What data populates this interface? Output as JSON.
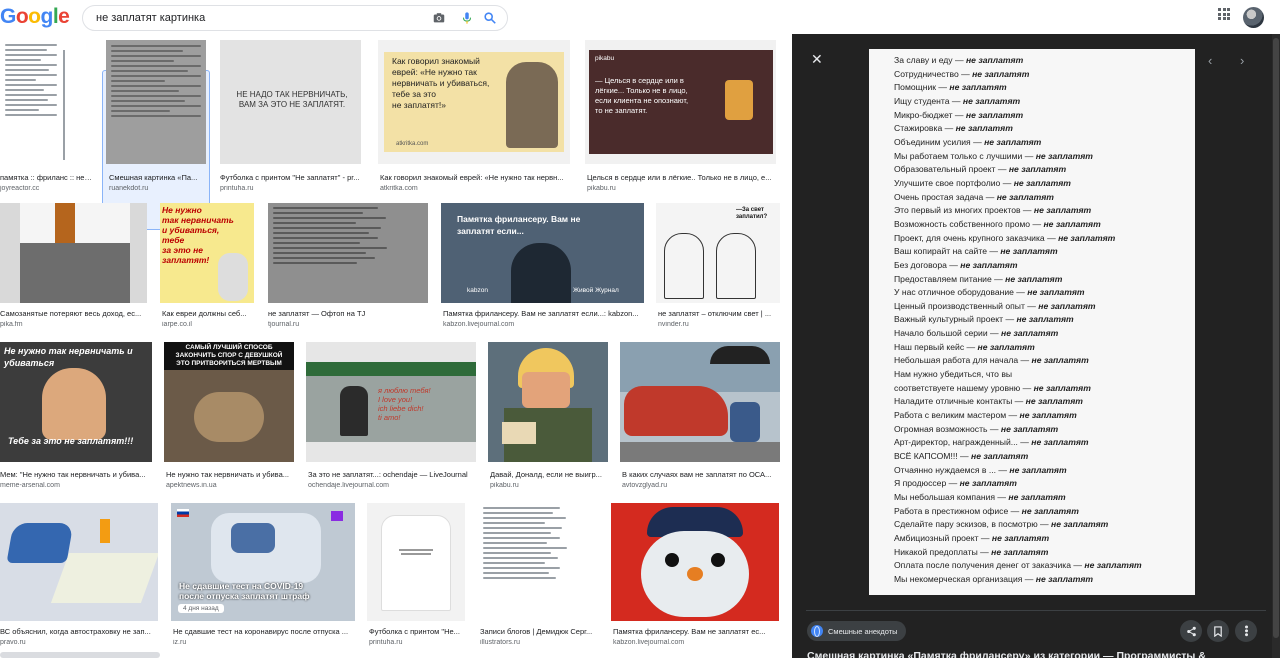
{
  "header": {
    "logo_letters": [
      {
        "ch": "G",
        "color": "#4285F4"
      },
      {
        "ch": "o",
        "color": "#EA4335"
      },
      {
        "ch": "o",
        "color": "#FBBC05"
      },
      {
        "ch": "g",
        "color": "#4285F4"
      },
      {
        "ch": "l",
        "color": "#34A853"
      },
      {
        "ch": "e",
        "color": "#EA4335"
      }
    ],
    "search_query": "не заплатят картинка",
    "icons": [
      "camera-icon",
      "microphone-icon",
      "search-icon",
      "apps-grid-icon"
    ]
  },
  "results": [
    {
      "title": "памятка :: фриланс :: не ...",
      "source": "joyreactor.cc"
    },
    {
      "title": "Смешная картинка «Па...",
      "source": "ruanekdot.ru"
    },
    {
      "title": "Футболка с принтом \"Не заплатят\" - pr...",
      "source": "printuha.ru",
      "inner": "НЕ НАДО ТАК НЕРВНИЧАТЬ,\nВАМ ЗА ЭТО НЕ ЗАПЛАТЯТ."
    },
    {
      "title": "Как говорил знакомый еврей: «Не нужно так нервн...",
      "source": "atkritka.com",
      "inner": "Как говорил знакомый\nеврей: «Не нужно так\nнервничать и убиваться,\nтебе за это\nне заплатят!»",
      "brand": "atkritka.com"
    },
    {
      "title": "Целься в сердце или в лёгкие.. Только не в лицо, е...",
      "source": "pikabu.ru",
      "inner": "— Целься в сердце или в\nлёгкие... Только не в лицо,\nесли клиента не опознают,\nто не заплатят.",
      "brand": "pikabu"
    },
    {
      "title": "Самозанятые потеряют весь доход, ес...",
      "source": "pika.fm"
    },
    {
      "title": "Как евреи должны себ...",
      "source": "iarpe.co.il",
      "inner": "Не нужно\nтак нервничать\nи убиваться,\nтебе\nза это не\nзаплатят!"
    },
    {
      "title": "не заплатят — Офтоп на TJ",
      "source": "tjournal.ru"
    },
    {
      "title": "Памятка фрилансеру. Вам не заплатят если...: kabzon...",
      "source": "kabzon.livejournal.com",
      "inner": "Памятка фрилансеру. Вам не\nзаплатят если...",
      "brand": "kabzon",
      "brand2": "Живой Журнал"
    },
    {
      "title": "не заплатят – отключим свет | ...",
      "source": "nvinder.ru",
      "inner": "—За свет\nзаплатил?"
    },
    {
      "title": "Мем: \"Не нужно так нервничать и убива...",
      "source": "meme-arsenal.com",
      "inner": "Не нужно так нервничать и\nубиваться",
      "inner2": "Тебе за это не заплатят!!!"
    },
    {
      "title": "Не нужно так нервничать и убива...",
      "source": "apektnews.in.ua",
      "inner": "САМЫЙ ЛУЧШИЙ СПОСОБ\nЗАКОНЧИТЬ СПОР С ДЕВУШКОЙ\nЭТО ПРИТВОРИТЬСЯ МЕРТВЫМ"
    },
    {
      "title": "За это не заплатят...: ochendaje — LiveJournal",
      "source": "ochendaje.livejournal.com",
      "inner": "я люблю тебя!\nI love you!\nich liebe dich!\nti amo!"
    },
    {
      "title": "Давай, Доналд, если не выигр...",
      "source": "pikabu.ru"
    },
    {
      "title": "В каких случаях вам не заплатят по ОСА...",
      "source": "avtovzglyad.ru"
    },
    {
      "title": "ВС объяснил, когда автостраховку не зап...",
      "source": "pravo.ru"
    },
    {
      "title": "Не сдавшие тест на коронавирус после отпуска ...",
      "source": "iz.ru",
      "inner": "Не сдавшие тест на COVID-19\nпосле отпуска заплатят штраф",
      "badge": "4 дня назад"
    },
    {
      "title": "Футболка с принтом \"Не...",
      "source": "printuha.ru"
    },
    {
      "title": "Записи блогов | Демидюк Серг...",
      "source": "illustrators.ru"
    },
    {
      "title": "Памятка фрилансеру. Вам не заплатят ес...",
      "source": "kabzon.livejournal.com"
    }
  ],
  "preview": {
    "suffix": "не заплатят",
    "lines": [
      "За славу и еду —",
      "Сотрудничество —",
      "Помощник —",
      "Ищу студента —",
      "Микро-бюджет —",
      "Стажировка —",
      "Объединим усилия —",
      "Мы работаем только с лучшими —",
      "Образовательный проект —",
      "Улучшите свое портфолио —",
      "Очень простая задача —",
      "Это первый из многих проектов —",
      "Возможность собственного промо —",
      "Проект, для очень крупного заказчика —",
      "Ваш копирайт на сайте —",
      "Без договора —",
      "Предоставляем питание —",
      "У нас отличное оборудование —",
      "Ценный производственный опыт —",
      "Важный культурный проект —",
      "Начало большой серии —",
      "Наш первый кейс —",
      "Небольшая работа для начала —",
      "Нам нужно убедиться, что вы",
      "соответствуете нашему уровню —",
      "Наладите отличные контакты —",
      "Работа с великим мастером —",
      "Огромная возможность —",
      "Арт-директор, награжденный... —",
      "ВСЁ КАПСОМ!!! —",
      "Отчаянно нуждаемся в ... —",
      "Я продюссер —",
      "Мы небольшая компания —",
      "Работа в престижном офисе —",
      "Сделайте пару эскизов, в посмотрю —",
      "Амбициозный проект —",
      "Никакой предоплаты —",
      "Оплата после получения денег от заказчика —",
      "Мы некомерческая организация —"
    ],
    "no_suffix_index": 23,
    "site_name": "Смешные анекдоты",
    "title": "Смешная картинка «Памятка фрилансеру» из категории — Программисты &"
  }
}
